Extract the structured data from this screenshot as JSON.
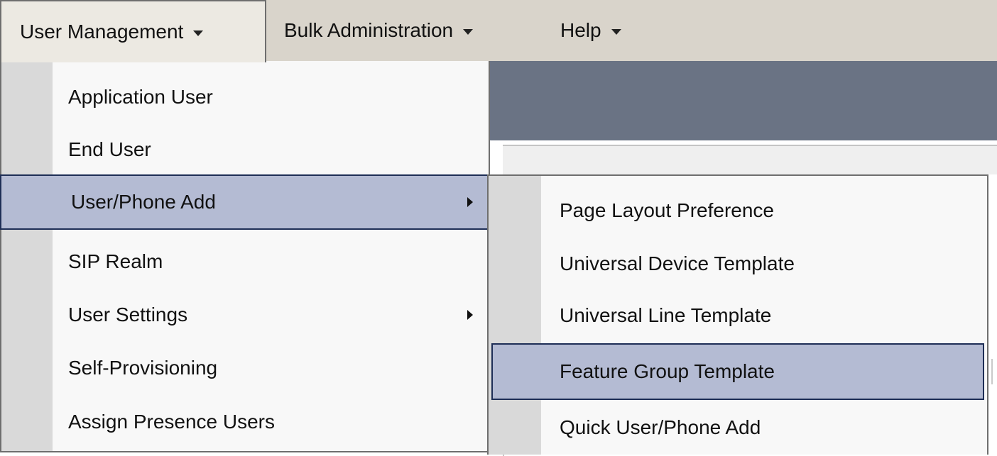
{
  "menubar": {
    "items": [
      {
        "label": "User Management"
      },
      {
        "label": "Bulk Administration"
      },
      {
        "label": "Help"
      }
    ]
  },
  "user_management_menu": {
    "items": [
      {
        "label": "Application User"
      },
      {
        "label": "End User"
      },
      {
        "label": "User/Phone Add"
      },
      {
        "label": "SIP Realm"
      },
      {
        "label": "User Settings"
      },
      {
        "label": "Self-Provisioning"
      },
      {
        "label": "Assign Presence Users"
      }
    ]
  },
  "user_phone_add_submenu": {
    "items": [
      {
        "label": "Page Layout Preference"
      },
      {
        "label": "Universal Device Template"
      },
      {
        "label": "Universal Line Template"
      },
      {
        "label": "Feature Group Template"
      },
      {
        "label": "Quick User/Phone Add"
      }
    ]
  },
  "colors": {
    "menubar_bg": "#d9d4cb",
    "header_band": "#6a7384",
    "highlight": "#b4bbd3",
    "highlight_border": "#1e2e56"
  }
}
